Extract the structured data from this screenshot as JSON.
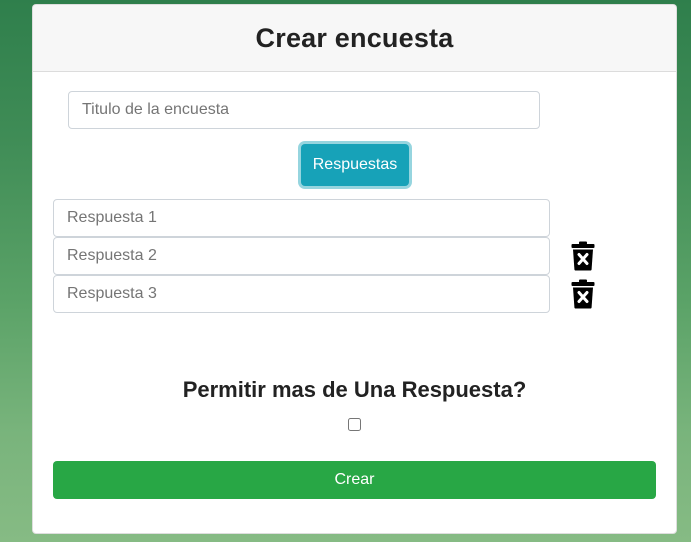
{
  "form": {
    "title": "Crear encuesta",
    "title_placeholder": "Titulo de la encuesta",
    "answers_button_label": "Respuestas",
    "answers": [
      {
        "placeholder": "Respuesta 1",
        "deletable": false
      },
      {
        "placeholder": "Respuesta 2",
        "deletable": true
      },
      {
        "placeholder": "Respuesta 3",
        "deletable": true
      }
    ],
    "multiple_question": "Permitir mas de Una Respuesta?",
    "multiple_checked": false,
    "submit_label": "Crear"
  },
  "colors": {
    "info_button": "#17a2b8",
    "success_button": "#28a745",
    "background_top": "#2f7f4c",
    "background_bottom": "#86bb84"
  },
  "icons": {
    "delete_answer": "trash-x-icon"
  }
}
